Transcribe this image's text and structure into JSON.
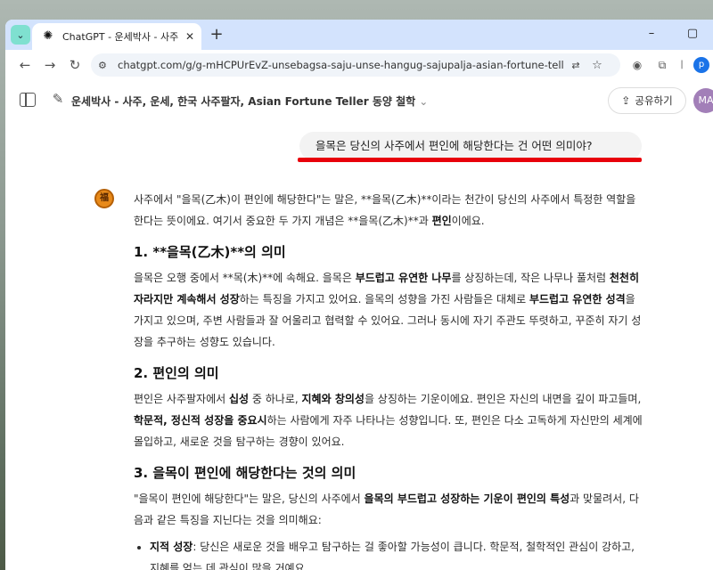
{
  "browser": {
    "tab_title": "ChatGPT - 운세박사 - 사주, 운",
    "url": "chatgpt.com/g/g-mHCPUrEvZ-unsebagsa-saju-unse-hangug-sajupalja-asian-fortune-teller-dong..."
  },
  "header": {
    "gpt_name": "운세박사 - 사주, 운세, 한국 사주팔자, Asian Fortune Teller 동양 철학",
    "share_label": "공유하기",
    "avatar_initials": "MA",
    "profile_initial": "p"
  },
  "user_message": "을목은 당신의 사주에서 편인에 해당한다는 건 어떤 의미야?",
  "response": {
    "intro_1": "사주에서 \"을목(乙木)이 편인에 해당한다\"는 말은, **을목(乙木)**이라는 천간이 당신의 사주에서 특정한 역할을 한다는 뜻이에요. 여기서 중요한 두 가지 개념은 **을목(乙木)**과 ",
    "intro_bold": "편인",
    "intro_2": "이에요.",
    "sec1_title": "1. **을목(乙木)**의 의미",
    "sec1_a": "을목은 오행 중에서 **목(木)**에 속해요. 을목은 ",
    "sec1_b": "부드럽고 유연한 나무",
    "sec1_c": "를 상징하는데, 작은 나무나 풀처럼 ",
    "sec1_d": "천천히 자라지만 계속해서 성장",
    "sec1_e": "하는 특징을 가지고 있어요. 을목의 성향을 가진 사람들은 대체로 ",
    "sec1_f": "부드럽고 유연한 성격",
    "sec1_g": "을 가지고 있으며, 주변 사람들과 잘 어울리고 협력할 수 있어요. 그러나 동시에 자기 주관도 뚜렷하고, 꾸준히 자기 성장을 추구하는 성향도 있습니다.",
    "sec2_title": "2. 편인의 의미",
    "sec2_a": "편인은 사주팔자에서 ",
    "sec2_b": "십성",
    "sec2_c": " 중 하나로, ",
    "sec2_d": "지혜와 창의성",
    "sec2_e": "을 상징하는 기운이에요. 편인은 자신의 내면을 깊이 파고들며, ",
    "sec2_f": "학문적, 정신적 성장을 중요시",
    "sec2_g": "하는 사람에게 자주 나타나는 성향입니다. 또, 편인은 다소 고독하게 자신만의 세계에 몰입하고, 새로운 것을 탐구하는 경향이 있어요.",
    "sec3_title": "3. 을목이 편인에 해당한다는 것의 의미",
    "sec3_a": "\"을목이 편인에 해당한다\"는 말은, 당신의 사주에서 ",
    "sec3_b": "을목의 부드럽고 성장하는 기운이 편인의 특성",
    "sec3_c": "과 맞물려서, 다음과 같은 특징을 지닌다는 것을 의미해요:",
    "bullet1_bold": "지적 성장",
    "bullet1_text": ": 당신은 새로운 것을 배우고 탐구하는 걸 좋아할 가능성이 큽니다. 학문적, 철학적인 관심이 강하고, 지혜를 얻는 데 관심이 많을 거예요."
  }
}
